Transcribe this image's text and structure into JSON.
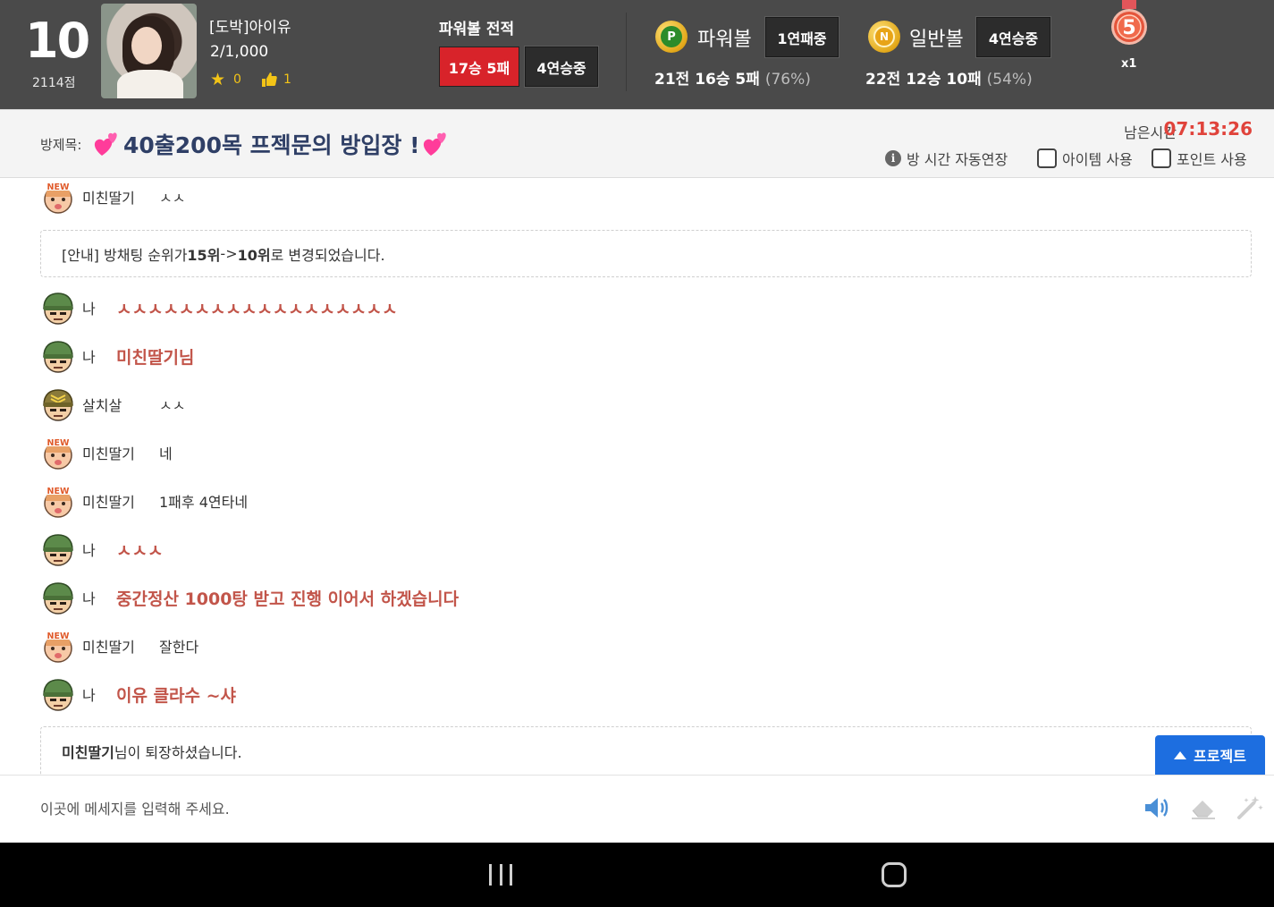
{
  "profile": {
    "rank": "10",
    "points": "2114점",
    "name": "[도박]아이유",
    "money": "2/1,000",
    "stars": "0",
    "likes": "1"
  },
  "powerball_record": {
    "title": "파워볼 전적",
    "record": "17승 5패",
    "streak": "4연승중"
  },
  "games": [
    {
      "ball": "P",
      "name": "파워볼",
      "streak": "1연패중",
      "stats": "21전 16승 5패",
      "pct": "(76%)"
    },
    {
      "ball": "N",
      "name": "일반볼",
      "streak": "4연승중",
      "stats": "22전 12승 10패",
      "pct": "(54%)"
    }
  ],
  "medal": {
    "number": "5",
    "count": "x1"
  },
  "room": {
    "label": "방제목:",
    "title": "40출200목 프젝문의 방입장 !",
    "time_label": "남은시간",
    "time_value": "07:13:26",
    "options": {
      "auto_extend": "방 시간 자동연장",
      "use_item": "아이템 사용",
      "use_point": "포인트 사용"
    }
  },
  "chat": {
    "messages": [
      {
        "level": "new",
        "nick": "미친딸기",
        "text": "ㅅㅅ",
        "mine": false
      },
      {
        "level": "soldier",
        "nick": "나",
        "text": "ㅅㅅㅅㅅㅅㅅㅅㅅㅅㅅㅅㅅㅅㅅㅅㅅㅅㅅ",
        "mine": true
      },
      {
        "level": "soldier",
        "nick": "나",
        "text": "미친딸기님",
        "mine": true
      },
      {
        "level": "sergeant",
        "nick": "살치살",
        "text": "ㅅㅅ",
        "mine": false
      },
      {
        "level": "new",
        "nick": "미친딸기",
        "text": "네",
        "mine": false
      },
      {
        "level": "new",
        "nick": "미친딸기",
        "text": "1패후 4연타네",
        "mine": false
      },
      {
        "level": "soldier",
        "nick": "나",
        "text": "ㅅㅅㅅ",
        "mine": true
      },
      {
        "level": "soldier",
        "nick": "나",
        "text": "중간정산 1000탕 받고 진행 이어서 하겠습니다",
        "mine": true
      },
      {
        "level": "new",
        "nick": "미친딸기",
        "text": "잘한다",
        "mine": false
      },
      {
        "level": "soldier",
        "nick": "나",
        "text": "이유 클라수 ~샤",
        "mine": true
      }
    ],
    "notice_rank": {
      "prefix": "[안내] 방채팅 순위가 ",
      "from": "15위",
      "arrow": " -> ",
      "to": "10위",
      "suffix": " 로 변경되었습니다."
    },
    "notice_leave": {
      "nick": "미친딸기",
      "suffix": "님이 퇴장하셨습니다."
    }
  },
  "project_button": "프로젝트",
  "input": {
    "placeholder": "이곳에 메세지를 입력해 주세요."
  },
  "colors": {
    "topbar": "#4a4a4a",
    "accent_red": "#d8232a",
    "time_red": "#e0433b",
    "my_text": "#c2554a",
    "project_blue": "#1d6ee0"
  }
}
